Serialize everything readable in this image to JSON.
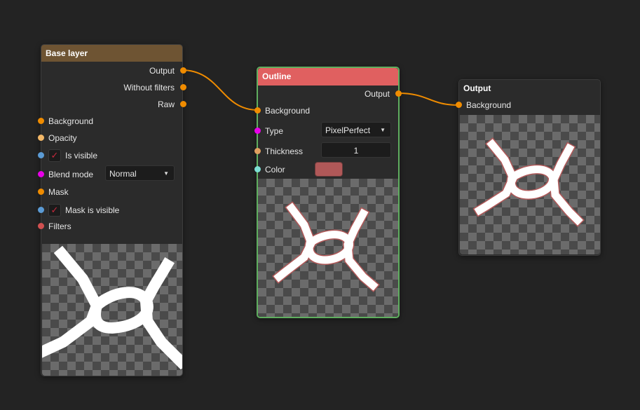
{
  "colors": {
    "socket_orange": "#f08c00",
    "socket_light_orange": "#f3b868",
    "socket_blue": "#5b9bd5",
    "socket_magenta": "#e800e8",
    "socket_red": "#d05050",
    "socket_cyan": "#7ee0d4",
    "socket_tan": "#e0a060",
    "base_header": "#6e5433",
    "outline_header": "#e06060",
    "outline_selected_border": "#5fae5f",
    "outline_color_value": "#b05858"
  },
  "base_layer": {
    "title": "Base layer",
    "outputs": [
      "Output",
      "Without filters",
      "Raw"
    ],
    "inputs": {
      "background": "Background",
      "opacity": "Opacity",
      "is_visible": "Is visible",
      "is_visible_checked": "✓",
      "blend_mode": "Blend mode",
      "blend_mode_value": "Normal",
      "mask": "Mask",
      "mask_is_visible": "Mask is visible",
      "mask_is_visible_checked": "✓",
      "filters": "Filters"
    }
  },
  "outline": {
    "title": "Outline",
    "output": "Output",
    "background": "Background",
    "type_label": "Type",
    "type_value": "PixelPerfect",
    "thickness_label": "Thickness",
    "thickness_value": "1",
    "color_label": "Color"
  },
  "output_node": {
    "title": "Output",
    "background": "Background"
  },
  "icons": {
    "dropdown": "chevron-down-icon",
    "check": "checkmark-icon"
  }
}
